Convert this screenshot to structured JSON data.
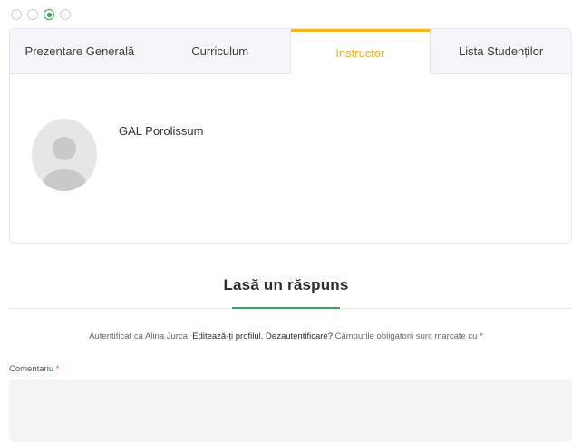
{
  "tabs": [
    {
      "label": "Prezentare Generală"
    },
    {
      "label": "Curriculum"
    },
    {
      "label": "Instructor"
    },
    {
      "label": "Lista Studenților"
    }
  ],
  "active_tab": "Instructor",
  "instructor": {
    "name": "GAL Porolissum"
  },
  "reply": {
    "title": "Lasă un răspuns",
    "logged_prefix": "Autentificat ca Alina Jurca. ",
    "edit_profile_link": "Editează-ți profilul.",
    "logout_link": "Dezautentificare?",
    "required_note": " Câmpurile obligatorii sunt marcate cu ",
    "required_star": "*",
    "comment_label": "Comentariu ",
    "comment_required": "*",
    "comment_value": ""
  },
  "colors": {
    "accent_orange": "#f5b421",
    "accent_green": "#3aa35a"
  }
}
